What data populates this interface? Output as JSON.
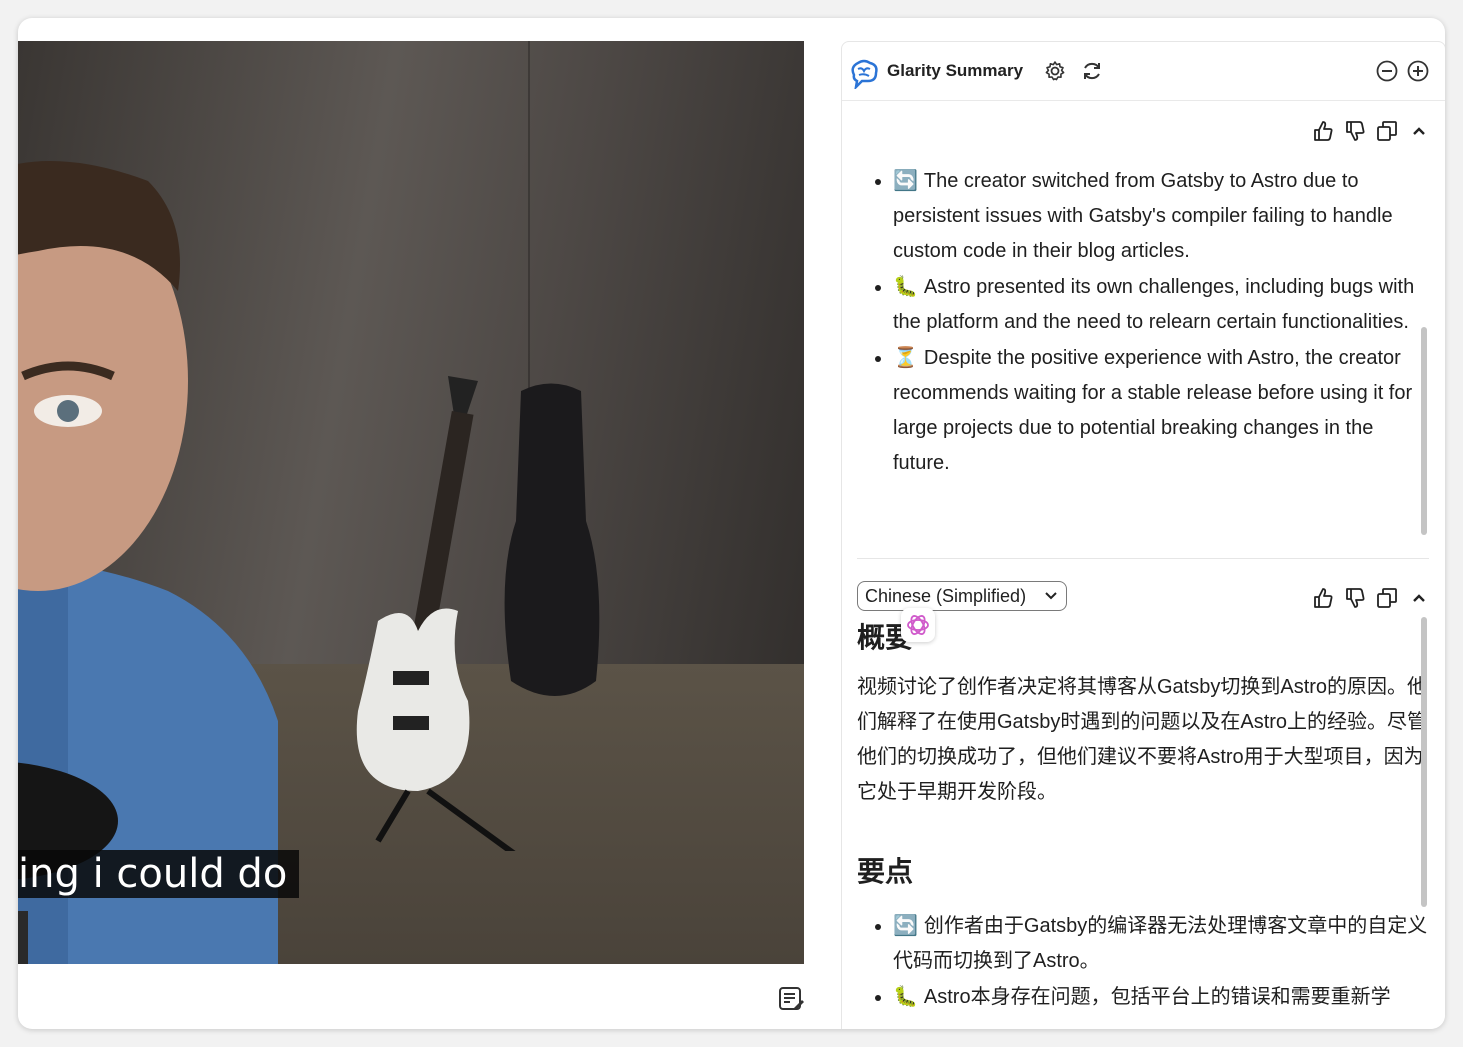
{
  "video": {
    "caption": "ing i could do",
    "notes_button_label": "notes-icon"
  },
  "panel": {
    "title": "Glarity Summary",
    "icons": {
      "logo": "glarity-brain-icon",
      "settings": "gear-icon",
      "refresh": "refresh-icon",
      "minimize": "minus-circle-icon",
      "expand": "plus-circle-icon"
    },
    "section_toolbar": [
      "thumbs-up-icon",
      "thumbs-down-icon",
      "copy-icon",
      "chevron-up-icon"
    ],
    "english_bullets": [
      {
        "emoji": "🔄",
        "text": "The creator switched from Gatsby to Astro due to persistent issues with Gatsby's compiler failing to handle custom code in their blog articles."
      },
      {
        "emoji": "🐛",
        "text": "Astro presented its own challenges, including bugs with the platform and the need to relearn certain functionalities."
      },
      {
        "emoji": "⏳",
        "text": "Despite the positive experience with Astro, the creator recommends waiting for a stable release before using it for large projects due to potential breaking changes in the future."
      }
    ],
    "language_select": {
      "value": "Chinese (Simplified)"
    },
    "chinese": {
      "summary_heading": "概要",
      "summary_text": "视频讨论了创作者决定将其博客从Gatsby切换到Astro的原因。他们解释了在使用Gatsby时遇到的问题以及在Astro上的经验。尽管他们的切换成功了，但他们建议不要将Astro用于大型项目，因为它处于早期开发阶段。",
      "points_heading": "要点",
      "bullets": [
        {
          "emoji": "🔄",
          "text": "创作者由于Gatsby的编译器无法处理博客文章中的自定义代码而切换到了Astro。"
        },
        {
          "emoji": "🐛",
          "text": "Astro本身存在问题，包括平台上的错误和需要重新学"
        }
      ]
    }
  }
}
